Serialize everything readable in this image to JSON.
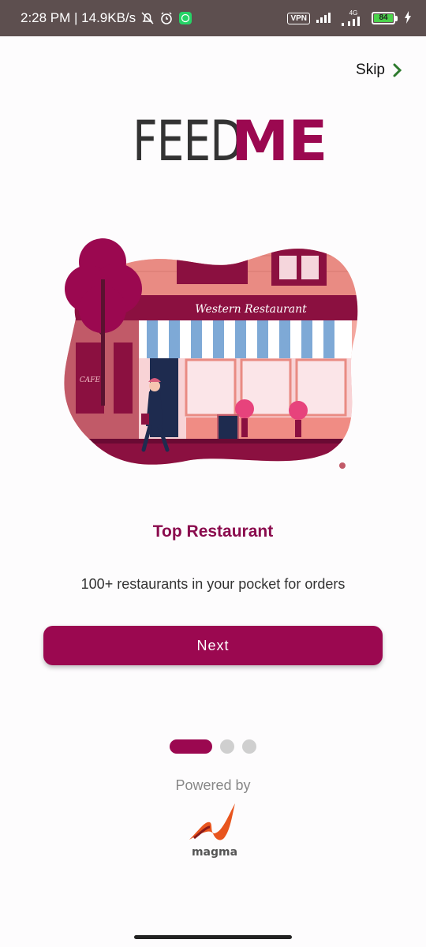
{
  "status_bar": {
    "time_and_speed": "2:28 PM | 14.9KB/s",
    "vpn": "VPN",
    "network": "4G",
    "battery": "84"
  },
  "header": {
    "skip_label": "Skip"
  },
  "logo": {
    "part1": "FEED",
    "part2": "ME"
  },
  "illustration": {
    "sign_text": "Western Restaurant",
    "cafe_text": "CAFE"
  },
  "onboarding": {
    "title": "Top Restaurant",
    "subtitle": "100+ restaurants in your pocket for orders",
    "next_label": "Next",
    "page_count": 3,
    "active_page": 1
  },
  "footer": {
    "powered_by": "Powered by",
    "brand": "magma"
  },
  "colors": {
    "primary": "#9b0850",
    "status_bar": "#5d4f4f",
    "inactive_dot": "#cfcfcf"
  }
}
